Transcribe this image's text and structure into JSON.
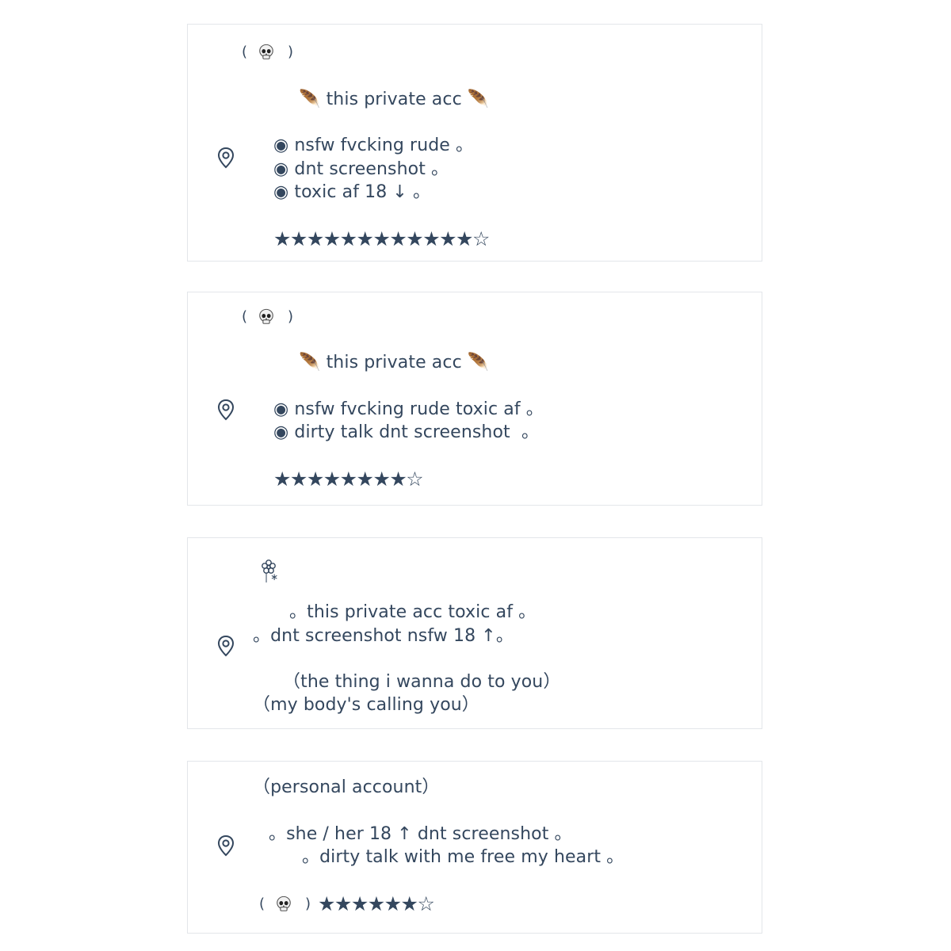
{
  "cards": [
    {
      "header": {
        "open": "(",
        "icon": "skull-emoji",
        "close": ")"
      },
      "title": "🪶 this private acc 🪶",
      "lines": [
        "◉ nsfw fvcking rude 。",
        "◉ dnt screenshot 。",
        "◉ toxic af 18 ↓ 。"
      ],
      "stars": "★★★★★★★★★★★★☆"
    },
    {
      "header": {
        "open": "(",
        "icon": "skull-emoji",
        "close": ")"
      },
      "title": "🪶 this private acc 🪶",
      "lines": [
        "◉ nsfw fvcking rude toxic af 。",
        "◉ dirty talk dnt screenshot  。"
      ],
      "stars": "★★★★★★★★☆"
    },
    {
      "header": {
        "icon": "flower-emoji",
        "sub": "❘∗"
      },
      "lines": [
        "。this private acc toxic af 。",
        "。dnt screenshot nsfw 18 ↑。",
        "（the thing i wanna do to you）",
        "（my body's calling you）"
      ]
    },
    {
      "title": "（personal account）",
      "lines": [
        "。she / her 18 ↑ dnt screenshot 。",
        "。dirty talk with me free my heart 。"
      ],
      "footer": {
        "open": "(",
        "icon": "skull-emoji",
        "close": ")",
        "stars": "★★★★★★☆"
      }
    }
  ],
  "icons": {
    "location": "location-pin-icon",
    "skull": "skull-icon",
    "flower": "flower-icon",
    "feather": "feather-icon"
  },
  "colors": {
    "text": "#34475e",
    "border": "#e3e6ea",
    "background": "#ffffff"
  }
}
